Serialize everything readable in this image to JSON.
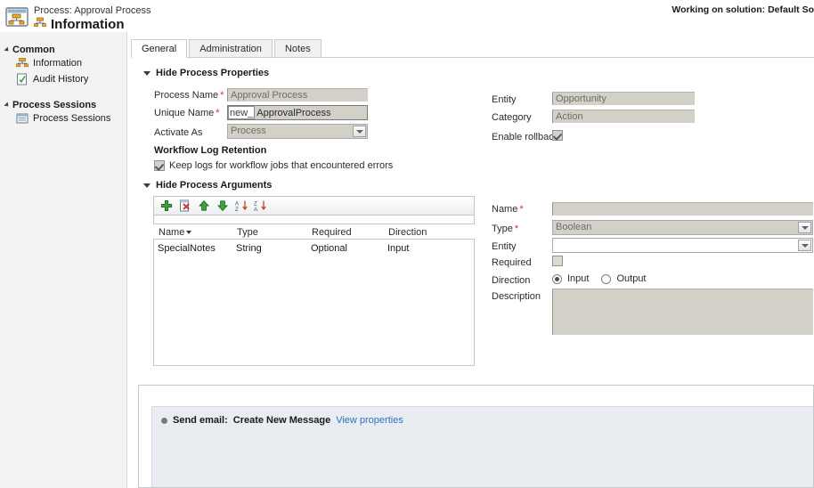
{
  "header": {
    "process_label": "Process: Approval Process",
    "title": "Information",
    "solution_note": "Working on solution: Default So",
    "app_icon": "process-window-icon",
    "title_icon": "process-node-icon"
  },
  "sidebar": {
    "groups": [
      {
        "label": "Common",
        "items": [
          {
            "label": "Information",
            "icon": "process-node-icon"
          },
          {
            "label": "Audit History",
            "icon": "audit-history-icon"
          }
        ]
      },
      {
        "label": "Process Sessions",
        "items": [
          {
            "label": "Process Sessions",
            "icon": "process-sessions-icon"
          }
        ]
      }
    ]
  },
  "tabs": [
    {
      "label": "General",
      "active": true
    },
    {
      "label": "Administration",
      "active": false
    },
    {
      "label": "Notes",
      "active": false
    }
  ],
  "process_properties": {
    "section_label": "Hide Process Properties",
    "process_name": {
      "label": "Process Name",
      "required": "*",
      "value": "Approval Process"
    },
    "unique_name": {
      "label": "Unique Name",
      "required": "*",
      "prefix": "new_",
      "value": "ApprovalProcess"
    },
    "activate_as": {
      "label": "Activate As",
      "value": "Process"
    },
    "entity": {
      "label": "Entity",
      "value": "Opportunity"
    },
    "category": {
      "label": "Category",
      "value": "Action"
    },
    "enable_rollback": {
      "label": "Enable rollback",
      "checked": true
    },
    "log_retention_heading": "Workflow Log Retention",
    "keep_logs": {
      "label": "Keep logs for workflow jobs that encountered errors",
      "checked": true
    }
  },
  "process_arguments": {
    "section_label": "Hide Process Arguments",
    "toolbar": [
      {
        "name": "add-argument-button",
        "icon": "green-plus-icon"
      },
      {
        "name": "delete-argument-button",
        "icon": "delete-page-icon"
      },
      {
        "name": "move-up-button",
        "icon": "green-up-arrow-icon"
      },
      {
        "name": "move-down-button",
        "icon": "green-down-arrow-icon"
      },
      {
        "name": "sort-ascending-button",
        "icon": "sort-a-z-icon"
      },
      {
        "name": "sort-descending-button",
        "icon": "sort-z-a-icon"
      }
    ],
    "columns": [
      "Name",
      "Type",
      "Required",
      "Direction"
    ],
    "rows": [
      {
        "name": "SpecialNotes",
        "type": "String",
        "required": "Optional",
        "direction": "Input"
      }
    ]
  },
  "argument_detail": {
    "name": {
      "label": "Name",
      "required": "*",
      "value": ""
    },
    "type": {
      "label": "Type",
      "required": "*",
      "value": "Boolean"
    },
    "entity": {
      "label": "Entity",
      "value": ""
    },
    "required_field": {
      "label": "Required",
      "checked": false
    },
    "direction": {
      "label": "Direction",
      "options": [
        {
          "label": "Input",
          "selected": true
        },
        {
          "label": "Output",
          "selected": false
        }
      ]
    },
    "description": {
      "label": "Description",
      "value": ""
    }
  },
  "steps": {
    "items": [
      {
        "icon": "step-dot-icon",
        "action": "Send email:",
        "target": "Create New Message",
        "link": "View properties"
      }
    ]
  },
  "colors": {
    "link": "#2a72c5",
    "required_asterisk": "#d32f2f",
    "field_fill": "#d3d0c8",
    "panel_bg": "#e9ecf0",
    "sidebar_bg": "#f3f3f3"
  }
}
